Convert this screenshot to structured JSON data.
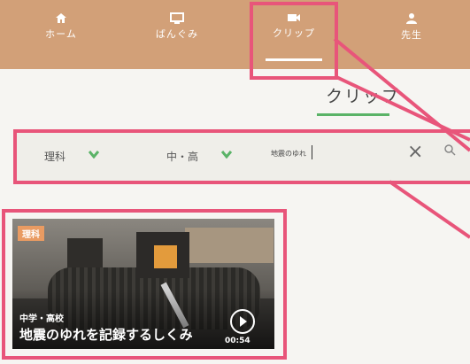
{
  "nav": {
    "items": [
      {
        "label": "ホーム",
        "icon": "home-icon"
      },
      {
        "label": "ばんぐみ",
        "icon": "tv-icon"
      },
      {
        "label": "クリップ",
        "icon": "video-icon",
        "active": true
      },
      {
        "label": "先生",
        "icon": "teacher-icon"
      }
    ]
  },
  "page": {
    "title": "クリップ"
  },
  "filters": {
    "subject": "理科",
    "grade": "中・高",
    "search_value": "地震のゆれ"
  },
  "card": {
    "subject_badge": "理科",
    "level": "中学・高校",
    "title": "地震のゆれを記録するしくみ",
    "duration": "00:54"
  },
  "colors": {
    "nav_bg": "#d2a078",
    "accent_green": "#5ab367",
    "callout": "#e8557a",
    "badge": "#e99b62"
  }
}
